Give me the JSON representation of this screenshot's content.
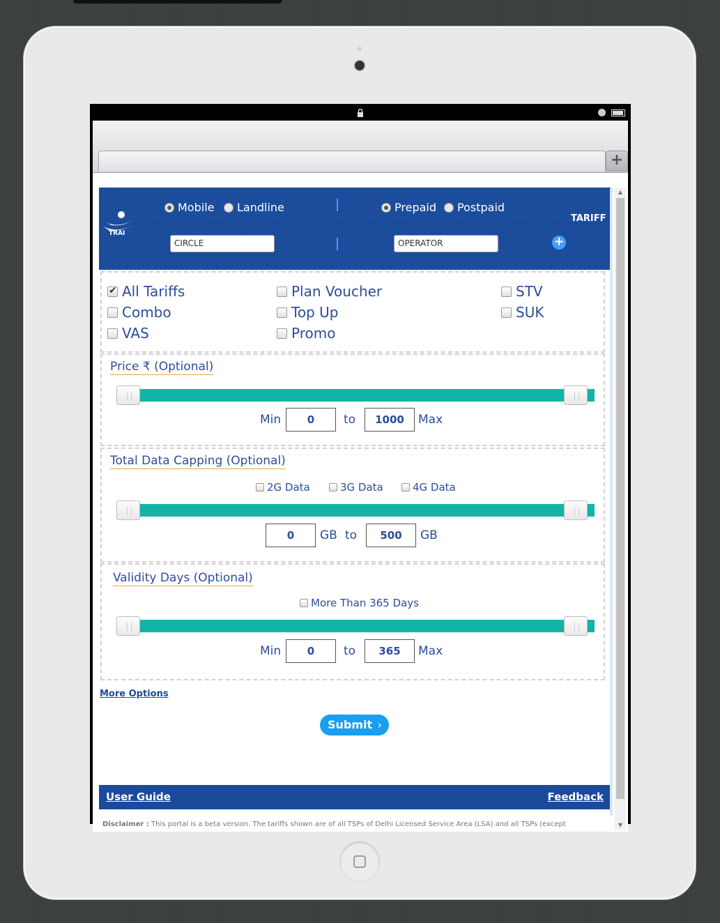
{
  "header": {
    "logo_text": "TRAI",
    "connection_options": [
      {
        "label": "Mobile",
        "selected": true
      },
      {
        "label": "Landline",
        "selected": false
      }
    ],
    "plan_options": [
      {
        "label": "Prepaid",
        "selected": true
      },
      {
        "label": "Postpaid",
        "selected": false
      }
    ],
    "circle_value": "CIRCLE",
    "operator_value": "OPERATOR",
    "tariff_label": "TARIFF"
  },
  "tariff_types": [
    {
      "label": "All Tariffs",
      "checked": true
    },
    {
      "label": "Plan Voucher",
      "checked": false
    },
    {
      "label": "STV",
      "checked": false
    },
    {
      "label": "Combo",
      "checked": false
    },
    {
      "label": "Top Up",
      "checked": false
    },
    {
      "label": "SUK",
      "checked": false
    },
    {
      "label": "VAS",
      "checked": false
    },
    {
      "label": "Promo",
      "checked": false
    }
  ],
  "price": {
    "title": "Price ₹ (Optional)",
    "min_label": "Min",
    "to_label": "to",
    "max_label": "Max",
    "min_value": "0",
    "max_value": "1000",
    "range_fraction": [
      0,
      1
    ]
  },
  "data_capping": {
    "title": "Total Data Capping (Optional)",
    "options": [
      "2G Data",
      "3G Data",
      "4G Data"
    ],
    "unit": "GB",
    "to_label": "to",
    "min_value": "0",
    "max_value": "500",
    "range_fraction": [
      0,
      1
    ]
  },
  "validity": {
    "title": "Validity Days (Optional)",
    "option": "More Than 365 Days",
    "min_label": "Min",
    "to_label": "to",
    "max_label": "Max",
    "min_value": "0",
    "max_value": "365",
    "range_fraction": [
      0,
      1
    ]
  },
  "more_options": "More Options",
  "submit_label": "Submit",
  "footer": {
    "user_guide": "User Guide",
    "feedback": "Feedback"
  },
  "disclaimer_label": "Disclaimer :",
  "disclaimer_text": "This portal is a beta version. The tariffs shown are of all TSPs of Delhi Licensed Service Area (LSA) and all TSPs (except"
}
